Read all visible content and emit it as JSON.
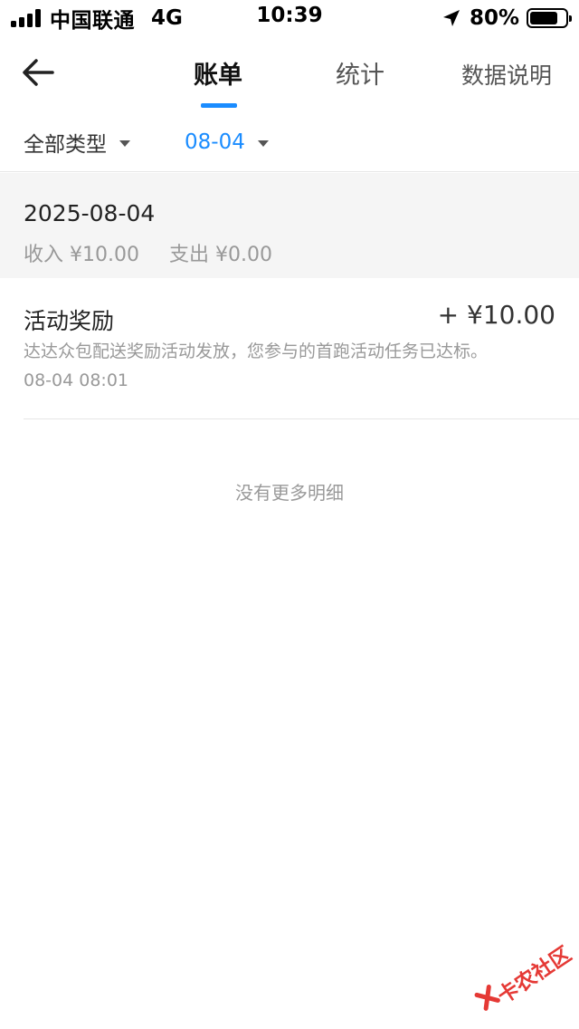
{
  "status_bar": {
    "carrier": "中国联通",
    "network": "4G",
    "time": "10:39",
    "battery_percent": "80%",
    "battery_level": 0.8,
    "icons": [
      "signal-icon",
      "location-arrow-icon",
      "battery-icon"
    ]
  },
  "nav": {
    "back_icon": "back-arrow-icon",
    "tabs": [
      {
        "label": "账单",
        "active": true
      },
      {
        "label": "统计",
        "active": false
      },
      {
        "label": "数据说明",
        "active": false
      }
    ],
    "accent_color": "#1a8cff"
  },
  "filters": {
    "type_label": "全部类型",
    "date_label": "08-04"
  },
  "summary": {
    "date": "2025-08-04",
    "income": "收入 ¥10.00",
    "expense": "支出 ¥0.00"
  },
  "records": [
    {
      "title": "活动奖励",
      "amount": "+ ¥10.00",
      "description": "达达众包配送奖励活动发放，您参与的首跑活动任务已达标。",
      "time": "08-04 08:01"
    }
  ],
  "footer_text": "没有更多明细",
  "watermark": {
    "text": "卡农社区"
  }
}
